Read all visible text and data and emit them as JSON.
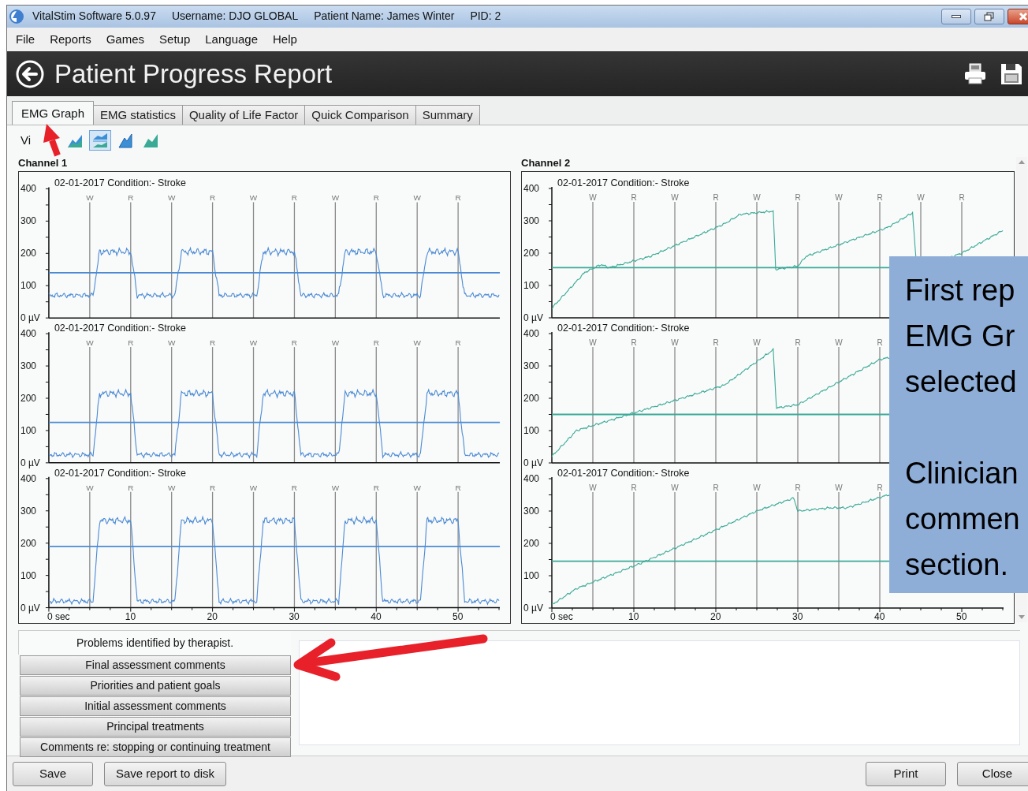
{
  "window": {
    "title_parts": [
      "VitalStim Software 5.0.97",
      "Username: DJO GLOBAL",
      "Patient Name: James Winter",
      "PID: 2"
    ]
  },
  "menu": [
    "File",
    "Reports",
    "Games",
    "Setup",
    "Language",
    "Help"
  ],
  "header": {
    "title": "Patient Progress Report"
  },
  "tabs": [
    {
      "label": "EMG Graph",
      "selected": true
    },
    {
      "label": "EMG statistics",
      "selected": false
    },
    {
      "label": "Quality of Life Factor",
      "selected": false
    },
    {
      "label": "Quick Comparison",
      "selected": false
    },
    {
      "label": "Summary",
      "selected": false
    }
  ],
  "view": {
    "label": "Vi",
    "buttons": [
      {
        "kind": "overlay",
        "selected": false
      },
      {
        "kind": "stacked",
        "selected": true
      },
      {
        "kind": "first",
        "selected": false
      },
      {
        "kind": "second",
        "selected": false
      }
    ]
  },
  "channels": [
    {
      "label": "Channel 1",
      "kind": "pulses",
      "color": "#4a8ad4",
      "plots": [
        {
          "title": "02-01-2017 Condition:- Stroke",
          "y_labels": [
            "400",
            "300",
            "200",
            "100",
            "0 µV"
          ],
          "markers": [
            "W",
            "R",
            "W",
            "R",
            "W",
            "R",
            "W",
            "R",
            "W",
            "R"
          ]
        },
        {
          "title": "02-01-2017 Condition:- Stroke",
          "y_labels": [
            "400",
            "300",
            "200",
            "100",
            "0 µV"
          ],
          "markers": [
            "W",
            "R",
            "W",
            "R",
            "W",
            "R",
            "W",
            "R",
            "W",
            "R"
          ]
        },
        {
          "title": "02-01-2017 Condition:- Stroke",
          "y_labels": [
            "400",
            "300",
            "200",
            "100",
            "0 µV"
          ],
          "markers": [
            "W",
            "R",
            "W",
            "R",
            "W",
            "R",
            "W",
            "R",
            "W",
            "R"
          ],
          "x_labels": [
            "0 sec",
            "10",
            "20",
            "30",
            "40",
            "50"
          ]
        }
      ]
    },
    {
      "label": "Channel 2",
      "kind": "ramp",
      "color": "#3aaa96",
      "plots": [
        {
          "title": "02-01-2017 Condition:- Stroke",
          "y_labels": [
            "400",
            "300",
            "200",
            "100",
            "0 µV"
          ],
          "markers": [
            "W",
            "R",
            "W",
            "R",
            "W",
            "R",
            "W",
            "R",
            "W",
            "R"
          ]
        },
        {
          "title": "02-01-2017 Condition:- Stroke",
          "y_labels": [
            "400",
            "300",
            "200",
            "100",
            "0 µV"
          ],
          "markers": [
            "W",
            "R",
            "W",
            "R",
            "W",
            "R",
            "W",
            "R"
          ]
        },
        {
          "title": "02-01-2017 Condition:- Stroke",
          "y_labels": [
            "400",
            "300",
            "200",
            "100",
            "0 µV"
          ],
          "markers": [
            "W",
            "R",
            "W",
            "R",
            "W",
            "R",
            "W",
            "R"
          ],
          "x_labels": [
            "0 sec",
            "10",
            "20",
            "30",
            "40",
            "50"
          ]
        }
      ]
    }
  ],
  "comments": {
    "items": [
      {
        "label": "Problems identified by therapist.",
        "selected": true
      },
      {
        "label": "Final assessment comments",
        "selected": false
      },
      {
        "label": "Priorities and patient goals",
        "selected": false
      },
      {
        "label": "Initial assessment comments",
        "selected": false
      },
      {
        "label": "Principal treatments",
        "selected": false
      },
      {
        "label": "Comments re: stopping or continuing treatment",
        "selected": false
      }
    ]
  },
  "buttons_left": [
    "Save",
    "Save report to disk"
  ],
  "buttons_right": [
    "Print",
    "Close"
  ],
  "callout": {
    "paragraphs": [
      [
        "First rep",
        "EMG Gr",
        "selected"
      ],
      [
        "Clinician",
        "commen",
        "section."
      ]
    ]
  }
}
